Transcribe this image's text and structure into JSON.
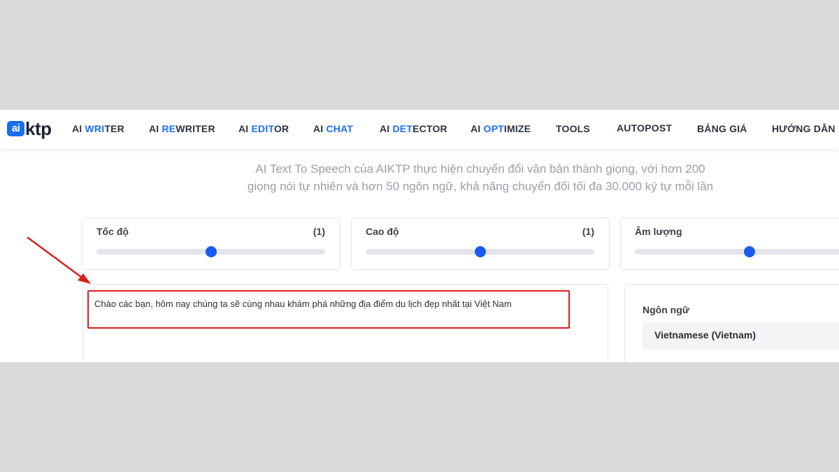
{
  "logo": {
    "mark": "ai",
    "text": "ktp"
  },
  "nav": [
    {
      "prefix": "AI ",
      "highlight": "WRI",
      "rest": "TER"
    },
    {
      "prefix": "AI ",
      "highlight": "RE",
      "rest": "WRITER"
    },
    {
      "prefix": "AI ",
      "highlight": "EDIT",
      "rest": "OR"
    },
    {
      "prefix": "AI ",
      "highlight": "CHAT",
      "rest": ""
    },
    {
      "prefix": "AI ",
      "highlight": "DET",
      "rest": "ECTOR"
    },
    {
      "prefix": "AI ",
      "highlight": "OPT",
      "rest": "IMIZE"
    },
    {
      "prefix": "TOOLS",
      "highlight": "",
      "rest": ""
    },
    {
      "prefix": "AUTOPOST",
      "highlight": "",
      "rest": ""
    },
    {
      "prefix": "BẢNG GIÁ",
      "highlight": "",
      "rest": ""
    },
    {
      "prefix": "HƯỚNG DẪN",
      "highlight": "",
      "rest": ""
    }
  ],
  "intro": {
    "line1": "AI Text To Speech của AIKTP thực hiện chuyển đổi văn bản thành giọng, với hơn 200",
    "line2": "giọng nói tự nhiên và hơn 50 ngôn ngữ, khả năng chuyển đổi tối đa 30.000 ký tự mỗi lần"
  },
  "sliders": [
    {
      "label": "Tốc độ",
      "value_text": "(1)",
      "level": 0.5
    },
    {
      "label": "Cao độ",
      "value_text": "(1)",
      "level": 0.5
    },
    {
      "label": "Âm lượng",
      "value_text": "",
      "level": 0.5
    }
  ],
  "text_input": {
    "value": "Chào các bạn, hôm nay chúng ta sẽ cùng nhau khám phá những địa điểm du lịch đẹp nhất tại Việt Nam"
  },
  "language": {
    "label": "Ngôn ngữ",
    "selected": "Vietnamese (Vietnam)"
  },
  "colors": {
    "accent": "#1a6ef5",
    "annotation": "#d61f1f",
    "page_bg": "#d9d9d9"
  },
  "icons": {
    "annotation_arrow": "arrow-icon"
  }
}
